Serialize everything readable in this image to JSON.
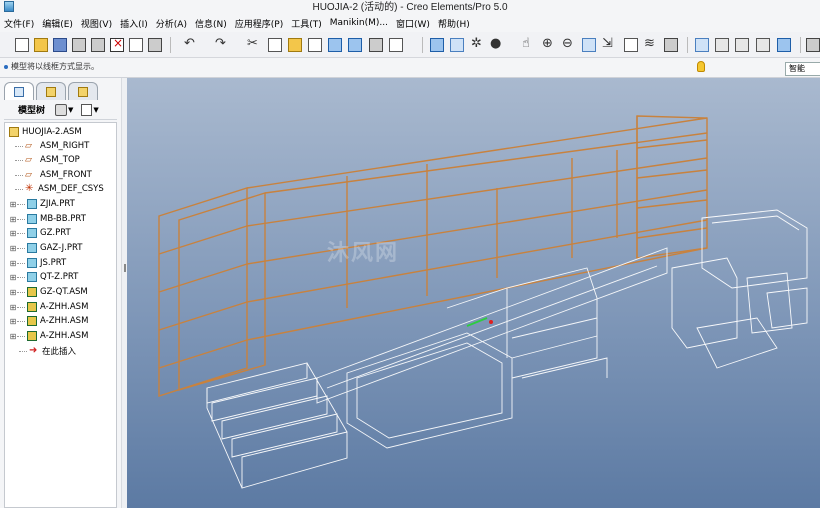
{
  "window": {
    "title": "HUOJIA-2 (活动的) - Creo Elements/Pro 5.0"
  },
  "menu": [
    "文件(F)",
    "编辑(E)",
    "视图(V)",
    "插入(I)",
    "分析(A)",
    "信息(N)",
    "应用程序(P)",
    "工具(T)",
    "Manikin(M)...",
    "窗口(W)",
    "帮助(H)"
  ],
  "message": {
    "text": "模型将以线框方式显示。"
  },
  "filter": {
    "value": "智能"
  },
  "model_tree": {
    "header": "模型树",
    "items": [
      {
        "label": "HUOJIA-2.ASM",
        "icon": "assembly-icon"
      },
      {
        "label": "ASM_RIGHT",
        "icon": "datum-plane-icon"
      },
      {
        "label": "ASM_TOP",
        "icon": "datum-plane-icon"
      },
      {
        "label": "ASM_FRONT",
        "icon": "datum-plane-icon"
      },
      {
        "label": "ASM_DEF_CSYS",
        "icon": "csys-icon"
      },
      {
        "label": "ZJIA.PRT",
        "icon": "part-icon"
      },
      {
        "label": "MB-BB.PRT",
        "icon": "part-icon"
      },
      {
        "label": "GZ.PRT",
        "icon": "part-icon"
      },
      {
        "label": "GAZ-J.PRT",
        "icon": "part-icon"
      },
      {
        "label": "JS.PRT",
        "icon": "part-icon"
      },
      {
        "label": "QT-Z.PRT",
        "icon": "part-icon"
      },
      {
        "label": "GZ-QT.ASM",
        "icon": "subassembly-icon"
      },
      {
        "label": "A-ZHH.ASM",
        "icon": "subassembly-icon"
      },
      {
        "label": "A-ZHH.ASM",
        "icon": "subassembly-icon"
      },
      {
        "label": "A-ZHH.ASM",
        "icon": "subassembly-icon"
      },
      {
        "label": "在此插入",
        "icon": "insert-here-icon"
      }
    ]
  },
  "watermark": "沐风网",
  "colors": {
    "shelf_edges": "#c8823e",
    "wireframe": "#ffffff",
    "viewport_top": "#a9b9cf",
    "viewport_bottom": "#5c7aa3"
  }
}
